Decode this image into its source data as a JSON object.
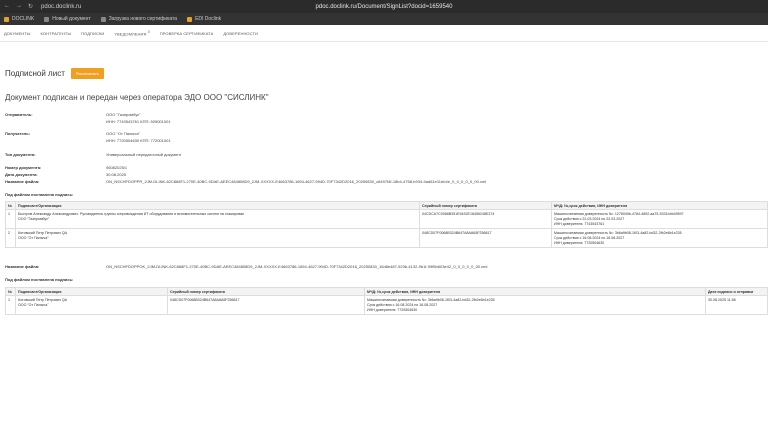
{
  "browser": {
    "short_url": "pdoc.doclink.ru",
    "full_url": "pdoc.doclink.ru/Document/SignList?docid=1659540",
    "bookmarks": [
      "DOCLINK",
      "Новый документ",
      "Загрузка нового сертификата",
      "EDI Doclink"
    ]
  },
  "nav": {
    "items": [
      "ДОКУМЕНТЫ",
      "КОНТРАГЕНТЫ",
      "ПОДПИСКИ",
      "УВЕДОМЛЕНИЯ",
      "ПРОВЕРКА СЕРТИФИКАТА",
      "ДОВЕРЕННОСТИ"
    ],
    "notif_count": "0"
  },
  "page": {
    "title": "Подписной лист",
    "print_label": "Распечатать",
    "heading": "Документ подписан и передан через оператора ЭДО ООО \"СИСЛИНК\""
  },
  "info": {
    "sender_label": "Отправитель:",
    "sender_name": "ООО \"Газпромбус\"",
    "sender_ids": "ИНН: 7743543761 КПП: 505001001",
    "receiver_label": "Получатель:",
    "receiver_name": "ООО \"От Палыча\"",
    "receiver_ids": "ИНН: 7720504630 КПП: 772001001",
    "doctype_label": "Тип документа:",
    "doctype_value": "Универсальный передаточный документ",
    "docnum_label": "Номер документа:",
    "docnum_value": "06082025/1",
    "docdate_label": "Дата документа:",
    "docdate_value": "30.08.2025",
    "filename_label": "Название файла:",
    "filename_value": "ON_NSCHFDOPPR_2JM-DLINK-62C868F1-270E-40BC-9DAE-AEEC484808D9_2JM-XXXXX-E4663786-1694-4627-994D-70F7342D2016_20250830_c8497f4f-18b4-4758-b934-9ad61e11eb4e_0_0_0_0_0_00.xml"
  },
  "table1": {
    "caption": "Под файлом поставлена подпись:",
    "headers": [
      "№",
      "Подписант/Организация",
      "Серийный номер сертификата",
      "МЧД: №,срок действия, ИНН доверителя"
    ],
    "rows": [
      {
        "n": "1",
        "signer": "Быстров Александр Александрович. Руководитель группы сопровождения ИТ оборудования и вспомогательных систем на стажировке",
        "org": "ООО \"Газпромбус\"",
        "serial": "04CDCA7C0068B351E9432E18456248E374",
        "mchd1": "Машиночитаемая доверенность №: 1276049b-4784-4892-aa75-5331b4b49597",
        "mchd2": "Срок действия с 22.03.2024 по 22.03.2027",
        "mchd3": "ИНН доверителя: 7743543761"
      },
      {
        "n": "2",
        "signer": "Котовский Петр Петрович  QA",
        "org": "ООО \"От Палыча\"",
        "serial": "048CD07F0068B324B647A8A8A5F256817",
        "mchd1": "Машиночитаемая доверенность №: 3b6a9b08-1f03-4a82-bd32-2fb2e6b1e235",
        "mchd2": "Срок действия с 16.08.2024 по 16.08.2027",
        "mchd3": "ИНН доверителя: 7720504630"
      }
    ]
  },
  "file2": {
    "label": "Название файла:",
    "value": "ON_NSCHFDOPPOK_2JM-DLINK-62C868F1-270E-40BC-9DAE-AEEC484808D9_2JM-XXXXX-E4663786-1694-4627-994D-70F7342D2016_20250830_16d8e487-923b-4132-9b1f-99f5b603e42_0_0_0_0_0_00.xml"
  },
  "table2": {
    "caption": "Под файлом поставлена подпись:",
    "headers": [
      "№",
      "Подписант/Организация",
      "Серийный номер сертификата",
      "МЧД: №,срок действия, ИНН доверителя",
      "Дата подписи и отправки"
    ],
    "rows": [
      {
        "n": "1",
        "signer": "Котовский Петр Петрович  QA",
        "org": "ООО \"От Палыча\"",
        "serial": "048CD07F0068B324B647A8A8A5F256817",
        "mchd1": "Машиночитаемая доверенность №: 3b6a9b08-1f03-4a82-bd32-2fb2e6b1e235",
        "mchd2": "Срок действия с 16.08.2024 по 16.08.2027",
        "mchd3": "ИНН доверителя: 7720504630",
        "date": "30.08.2025 11:56"
      }
    ]
  }
}
